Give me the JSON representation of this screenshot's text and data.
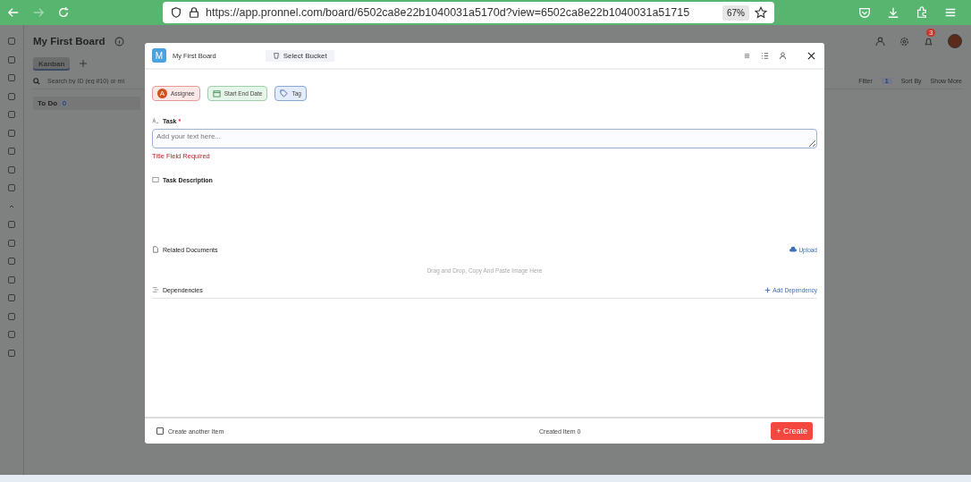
{
  "browser": {
    "url": "https://app.pronnel.com/board/6502ca8e22b1040031a5170d?view=6502ca8e22b1040031a51715",
    "zoom": "67%"
  },
  "board": {
    "title": "My First Board",
    "tabs": [
      {
        "label": "Kanban",
        "selected": true
      }
    ],
    "search": {
      "placeholder": "Search by ID (eg #10) or mi"
    },
    "columns": [
      {
        "title": "To Do",
        "count": "0"
      }
    ],
    "toolbar": {
      "filter": "Filter",
      "filter_count": "1",
      "sort": "Sort By",
      "more": "Show More"
    },
    "notifications": "3"
  },
  "modal": {
    "board_initial": "M",
    "board_name": "My First Board",
    "bucket": "Select Bucket",
    "chips": [
      {
        "kind": "assignee",
        "label": "Assignee",
        "initial": "A"
      },
      {
        "kind": "date",
        "label": "Start End Date"
      },
      {
        "kind": "tag",
        "label": "Tag"
      }
    ],
    "task": {
      "label": "Task",
      "required_mark": "*",
      "placeholder": "Add your text here...",
      "error": "Title Field Required"
    },
    "description": {
      "label": "Task Description"
    },
    "documents": {
      "label": "Related Documents",
      "upload": "Upload",
      "dropzone": "Drag and Drop, Copy And Paste Image Here"
    },
    "dependencies": {
      "label": "Dependencies",
      "add": "Add Dependency"
    },
    "footer": {
      "create_another": {
        "label": "Create another Item",
        "checked": false
      },
      "created": "Created Item 0",
      "create_button": "+ Create"
    }
  }
}
